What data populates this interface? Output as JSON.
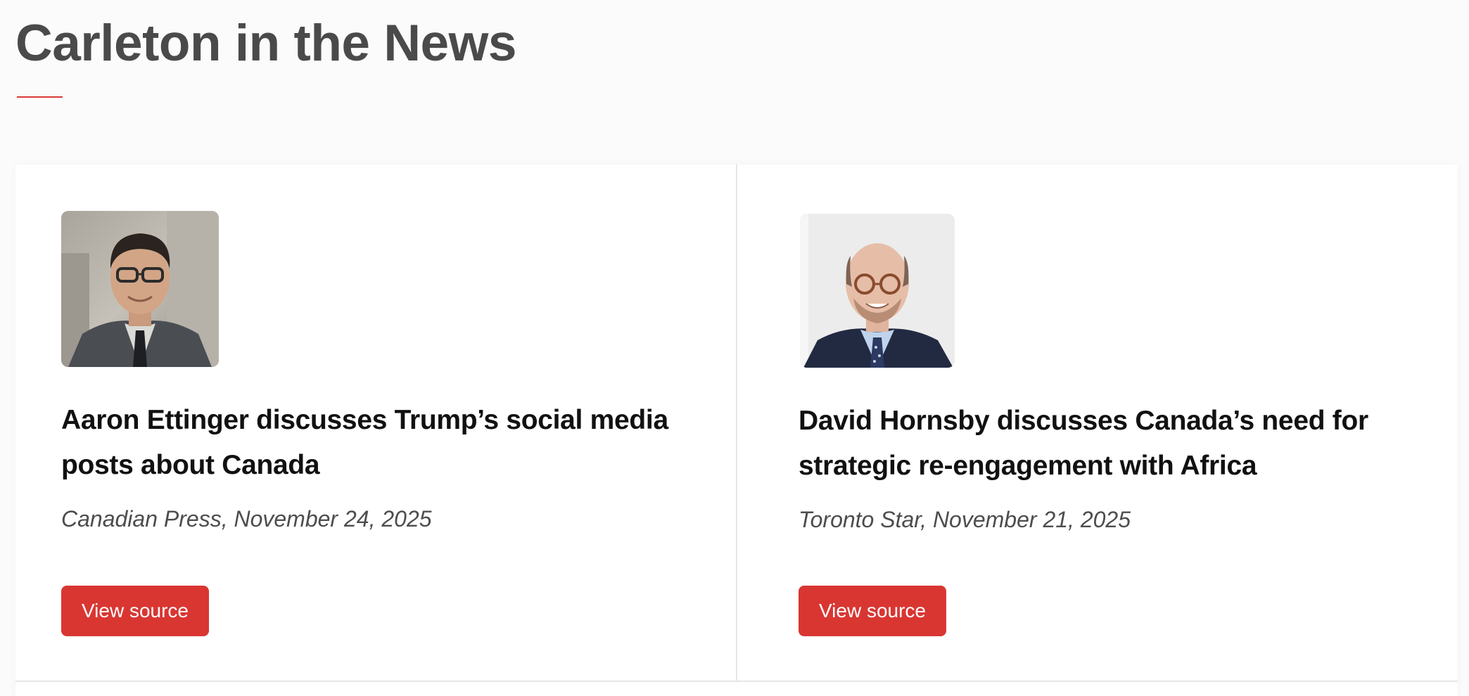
{
  "section": {
    "title": "Carleton in the News",
    "accent_color": "#d93632"
  },
  "articles": [
    {
      "headline": "Aaron Ettinger discusses Trump’s social media posts about Canada",
      "source_line": "Canadian Press, November 24, 2025",
      "button_label": "View source",
      "photo": "portrait-aaron-ettinger"
    },
    {
      "headline": "David Hornsby discusses Canada’s need for strategic re-engagement with Africa",
      "source_line": "Toronto Star, November 21, 2025",
      "button_label": "View source",
      "photo": "portrait-david-hornsby"
    }
  ]
}
